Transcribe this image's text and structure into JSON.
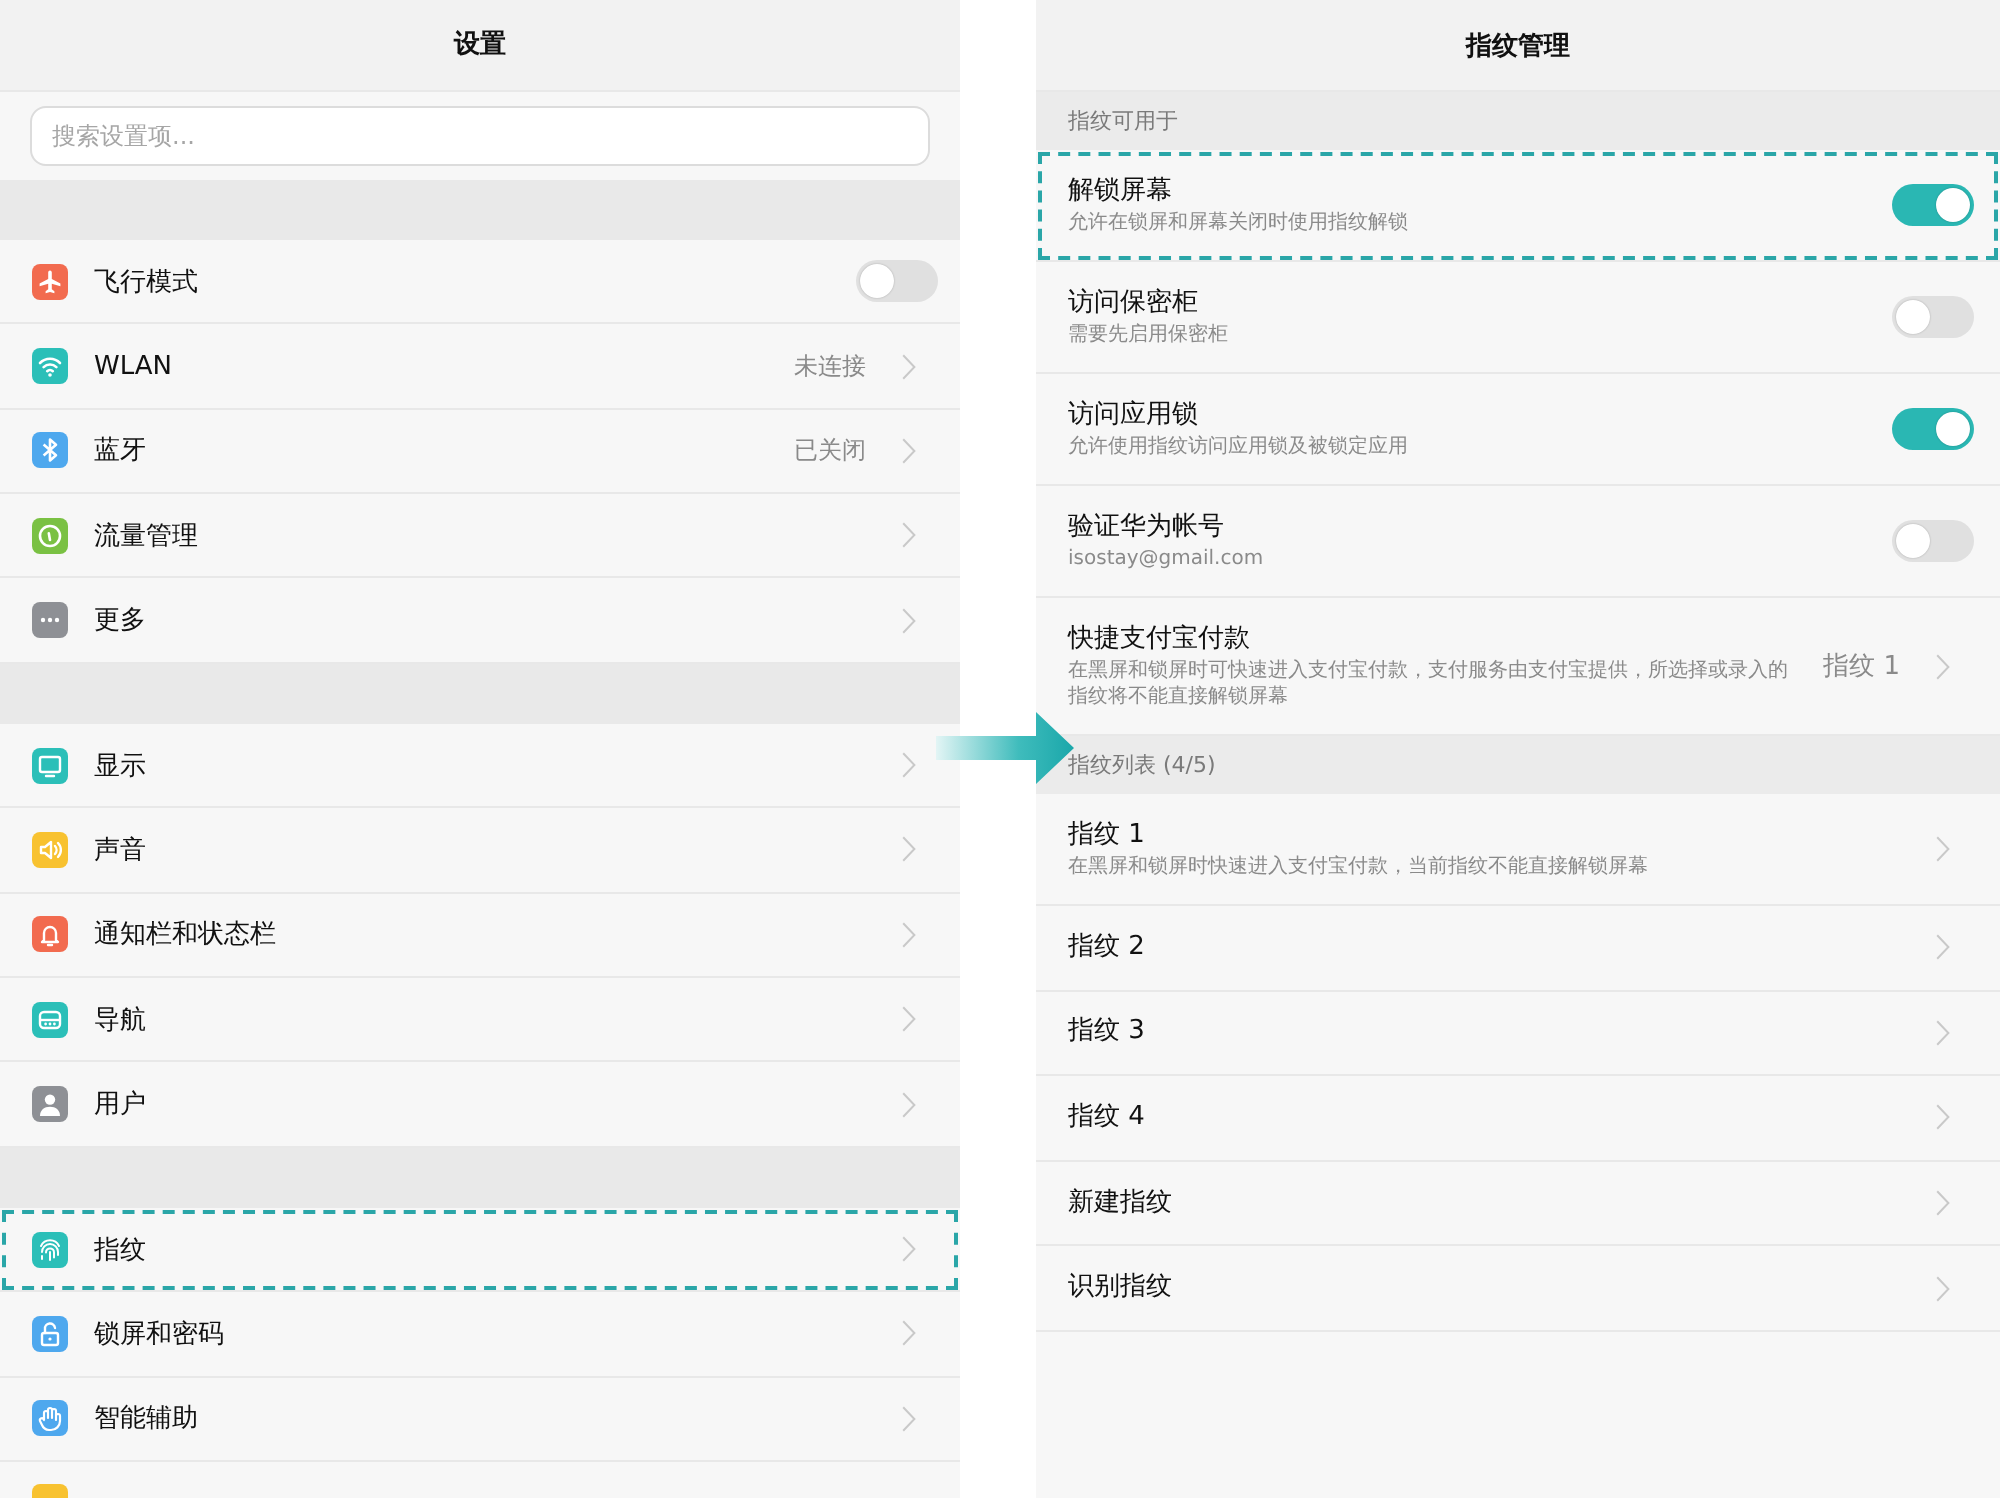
{
  "left": {
    "title": "设置",
    "search": {
      "placeholder": "搜索设置项..."
    },
    "sections": [
      {
        "items": [
          {
            "label": "飞行模式",
            "kind": "toggle",
            "on": false,
            "highlighted": false
          },
          {
            "label": "WLAN",
            "kind": "link",
            "value": "未连接",
            "highlighted": false
          },
          {
            "label": "蓝牙",
            "kind": "link",
            "value": "已关闭",
            "highlighted": false
          },
          {
            "label": "流量管理",
            "kind": "link",
            "highlighted": false
          },
          {
            "label": "更多",
            "kind": "link",
            "highlighted": false
          }
        ]
      },
      {
        "items": [
          {
            "label": "显示",
            "kind": "link",
            "highlighted": false
          },
          {
            "label": "声音",
            "kind": "link",
            "highlighted": false
          },
          {
            "label": "通知栏和状态栏",
            "kind": "link",
            "highlighted": false
          },
          {
            "label": "导航",
            "kind": "link",
            "highlighted": false
          },
          {
            "label": "用户",
            "kind": "link",
            "highlighted": false
          }
        ]
      },
      {
        "items": [
          {
            "label": "指纹",
            "kind": "link",
            "highlighted": true
          },
          {
            "label": "锁屏和密码",
            "kind": "link",
            "highlighted": false
          },
          {
            "label": "智能辅助",
            "kind": "link",
            "highlighted": false
          },
          {
            "kind": "partial",
            "highlighted": false
          }
        ]
      }
    ]
  },
  "right": {
    "title": "指纹管理",
    "groups": [
      {
        "header": "指纹可用于",
        "items": [
          {
            "title": "解锁屏幕",
            "subtitle": "允许在锁屏和屏幕关闭时使用指纹解锁",
            "kind": "toggle",
            "on": true,
            "highlighted": true
          },
          {
            "title": "访问保密柜",
            "subtitle": "需要先启用保密柜",
            "kind": "toggle",
            "on": false,
            "highlighted": false
          },
          {
            "title": "访问应用锁",
            "subtitle": "允许使用指纹访问应用锁及被锁定应用",
            "kind": "toggle",
            "on": true,
            "highlighted": false
          },
          {
            "title": "验证华为帐号",
            "subtitle": "isostay@gmail.com",
            "kind": "toggle",
            "on": false,
            "highlighted": false
          },
          {
            "title": "快捷支付宝付款",
            "subtitle": "在黑屏和锁屏时可快速进入支付宝付款，支付服务由支付宝提供，所选择或录入的指纹将不能直接解锁屏幕",
            "kind": "link",
            "value": "指纹 1",
            "highlighted": false
          }
        ]
      },
      {
        "header": "指纹列表 (4/5)",
        "items": [
          {
            "title": "指纹 1",
            "subtitle": "在黑屏和锁屏时快速进入支付宝付款，当前指纹不能直接解锁屏幕",
            "kind": "link",
            "highlighted": false
          },
          {
            "title": "指纹 2",
            "kind": "link",
            "highlighted": false
          },
          {
            "title": "指纹 3",
            "kind": "link",
            "highlighted": false
          },
          {
            "title": "指纹 4",
            "kind": "link",
            "highlighted": false
          },
          {
            "title": "新建指纹",
            "kind": "link",
            "highlighted": false
          },
          {
            "title": "识别指纹",
            "kind": "link",
            "highlighted": false
          }
        ]
      }
    ]
  }
}
